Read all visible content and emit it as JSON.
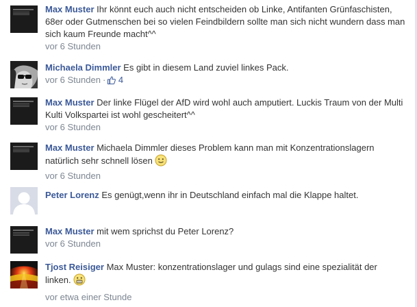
{
  "comments": [
    {
      "author": "Max Muster",
      "text": "Ihr könnt euch auch nicht entscheiden ob Linke, Antifanten Grünfaschisten, 68er oder Gutmenschen bei so vielen Feindbildern sollte man sich nicht wundern dass man sich kaum Freunde macht^^",
      "time": "vor 6 Stunden",
      "avatar": "dark-logo"
    },
    {
      "author": "Michaela Dimmler",
      "text": "Es gibt in diesem Land zuviel linkes Pack.",
      "time": "vor 6 Stunden",
      "separator": "·",
      "likes": "4",
      "avatar": "woman-sunglasses"
    },
    {
      "author": "Max Muster",
      "text": "Der linke Flügel der AfD wird wohl auch amputiert. Luckis Traum von der Multi Kulti Volkspartei ist wohl gescheitert^^",
      "time": "vor 6 Stunden",
      "avatar": "dark-logo"
    },
    {
      "author": "Max Muster",
      "text": "Michaela Dimmler dieses Problem kann man mit Konzentrationslagern natürlich sehr schnell lösen",
      "emoji": "smile-emoji",
      "time": "vor 6 Stunden",
      "avatar": "dark-logo"
    },
    {
      "author": "Peter Lorenz",
      "text": "Es genügt,wenn ihr in Deutschland einfach mal die Klappe haltet.",
      "time": "",
      "avatar": "default-silhouette"
    },
    {
      "author": "Max Muster",
      "text": "mit wem sprichst du Peter Lorenz?",
      "time": "vor 6 Stunden",
      "avatar": "dark-logo"
    },
    {
      "author": "Tjost Reisiger",
      "text": "Max Muster: konzentrationslager und gulags sind eine spezialität der linken.",
      "emoji": "grimace-emoji",
      "time": "vor etwa einer Stunde",
      "avatar": "german-flag"
    }
  ],
  "colors": {
    "author": "#3b5998",
    "text": "#333333",
    "meta": "#7d8692"
  }
}
